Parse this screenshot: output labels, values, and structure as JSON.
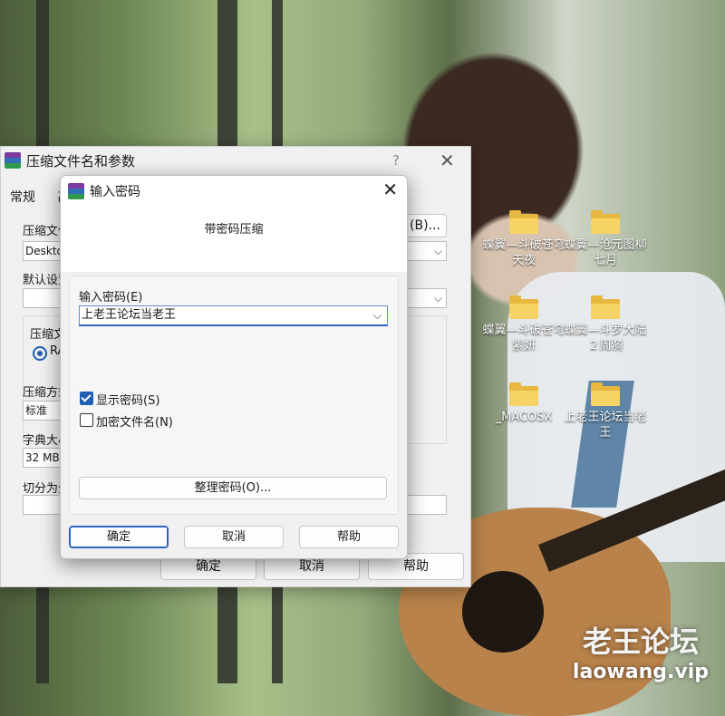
{
  "desktop": {
    "icons": [
      {
        "label": "蝶翼—斗破苍穹 天夜"
      },
      {
        "label": "蝶翼—沧元图柳七月"
      },
      {
        "label": "蝶翼—斗破苍穹 紫妍"
      },
      {
        "label": "蝶翼—斗罗大陆２周漪"
      },
      {
        "label": "_MACOSX"
      },
      {
        "label": "上老王论坛当老王"
      }
    ],
    "watermark": {
      "title": "老王论坛",
      "url": "laowang.vip"
    }
  },
  "back_window": {
    "title": "压缩文件名和参数",
    "help_glyph": "?",
    "tabs": [
      "常规",
      "高"
    ],
    "label_archive_name": "压缩文件",
    "archive_name_value": "Deskto",
    "browse_label": "(B)...",
    "label_default_profile": "默认设置",
    "group_format_label": "压缩文",
    "format_option": "RA",
    "label_method": "压缩方式",
    "method_value": "标准",
    "label_dictionary": "字典大小",
    "dictionary_value": "32 MB",
    "label_split": "切分为分",
    "ok_label": "确定",
    "cancel_label": "取消",
    "help_label": "帮助"
  },
  "dialog": {
    "title": "输入密码",
    "heading": "带密码压缩",
    "password_label": "输入密码(E)",
    "password_value": "上老王论坛当老王",
    "show_password_label": "显示密码(S)",
    "show_password_checked": true,
    "encrypt_names_label": "加密文件名(N)",
    "encrypt_names_checked": false,
    "organize_label": "整理密码(O)...",
    "ok_label": "确定",
    "cancel_label": "取消",
    "help_label": "帮助"
  },
  "colors": {
    "accent": "#1e5fb4",
    "folder": "#f7d365"
  }
}
